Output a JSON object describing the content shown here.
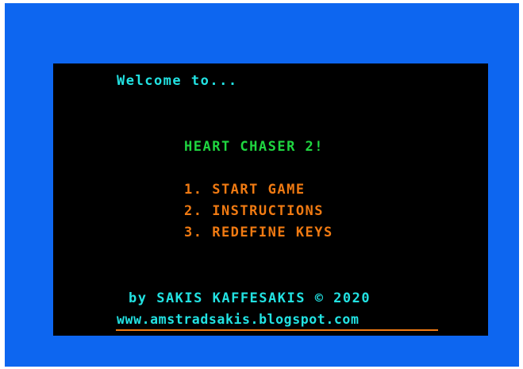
{
  "colors": {
    "border": "#0d66f0",
    "screen": "#000000",
    "cyan": "#22e2e2",
    "green": "#1fd640",
    "orange": "#f07a12"
  },
  "screen": {
    "welcome": "Welcome to...",
    "title": "HEART CHASER 2!",
    "menu": [
      "1. START GAME",
      "2. INSTRUCTIONS",
      "3. REDEFINE KEYS"
    ],
    "credit": "by SAKIS KAFFESAKIS © 2020",
    "url": "www.amstradsakis.blogspot.com"
  }
}
